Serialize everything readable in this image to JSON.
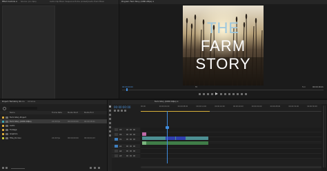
{
  "source_panel": {
    "tab_label": "Effect Controls ≡",
    "secondary_label": "Source: (no clips)",
    "path_text": "Audio Clip Mixer: Sequence Home (Linked)/Audio Track Mixer"
  },
  "program_monitor": {
    "tab_label": "Program: Farm Story (1080 24fps) ≡",
    "poster_lines": [
      "THE",
      "FARM",
      "STORY"
    ],
    "timecode_left": "00:00:00:00",
    "fit_label": "Fit",
    "quality_label": "Full",
    "timecode_right": "00:00:18:21"
  },
  "project_panel": {
    "tabs": [
      "Project: Farmstory ≡",
      "Media",
      "Libraries"
    ],
    "search_placeholder": "",
    "columns": [
      "Name",
      "Frame Rate",
      "Media Start",
      "Media End"
    ],
    "items": [
      {
        "color": "#d9a93a",
        "name": "Farm Story Project",
        "rate": "",
        "start": "",
        "end": ""
      },
      {
        "color": "#3aa7b3",
        "name": "Farm Story (1080 24fps)",
        "rate": "24.00 fps",
        "start": "00:00:00:00",
        "end": "00:00:18:21"
      },
      {
        "color": "#d9a93a",
        "name": "Audio",
        "rate": "",
        "start": "",
        "end": ""
      },
      {
        "color": "#d9a93a",
        "name": "Footage",
        "rate": "",
        "start": "",
        "end": ""
      },
      {
        "color": "#d9a93a",
        "name": "Graphics",
        "rate": "",
        "start": "",
        "end": ""
      },
      {
        "color": "#c8c83a",
        "name": "Title_01.mov",
        "rate": "24.00 fps",
        "start": "00:00:00:00",
        "end": "00:00:04:23"
      }
    ]
  },
  "timeline": {
    "tab_label": "Farm Story (1080 24fps) ≡",
    "timecode": "00:00:00:00",
    "ruler": [
      "00:00",
      "00:00:04:00",
      "00:00:08:00",
      "00:00:12:00",
      "00:00:16:00",
      "00:00:20:00",
      "00:00:24:00",
      "00:00:28:00",
      "00:00:32:00",
      "00:00:36:00"
    ],
    "tracks": [
      "V3",
      "V2",
      "V1",
      "A1",
      "A2",
      "A3"
    ]
  },
  "colors": {
    "accent": "#3f8de0",
    "playhead": "#3f8de0",
    "video_clip": "#5f9ea0",
    "title_clip": "#c06aa8",
    "audio_clip": "#5a9a62"
  }
}
